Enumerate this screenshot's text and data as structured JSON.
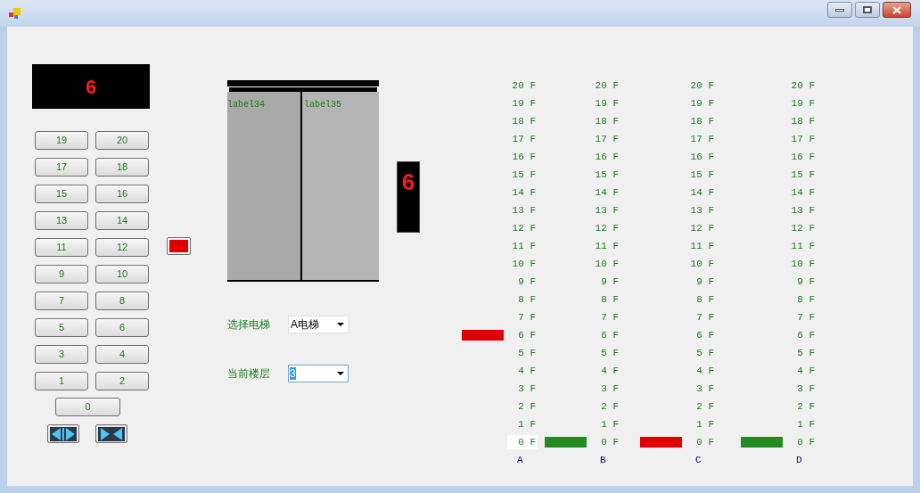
{
  "floor_display": {
    "value": "6"
  },
  "floor_buttons": [
    "19",
    "20",
    "17",
    "18",
    "15",
    "16",
    "13",
    "14",
    "11",
    "12",
    "9",
    "10",
    "7",
    "8",
    "5",
    "6",
    "3",
    "4",
    "1",
    "2"
  ],
  "ground_button": "0",
  "door_buttons": [
    {
      "kind": "open"
    },
    {
      "kind": "close"
    }
  ],
  "alarm_lamp": {
    "on": true
  },
  "doors": {
    "left_label": "label34",
    "right_label": "label35"
  },
  "side_display": {
    "value": "6"
  },
  "elevator_select": {
    "label": "选择电梯",
    "value": "A电梯"
  },
  "floor_select": {
    "label": "当前楼层",
    "value": "3",
    "selected": true
  },
  "shafts": [
    {
      "name": "A",
      "floors": [
        {
          "label": "20 F",
          "highlighted": false
        },
        {
          "label": "19 F",
          "highlighted": false
        },
        {
          "label": "18 F",
          "highlighted": false
        },
        {
          "label": "17 F",
          "highlighted": false
        },
        {
          "label": "16 F",
          "highlighted": false
        },
        {
          "label": "15 F",
          "highlighted": false
        },
        {
          "label": "14 F",
          "highlighted": false
        },
        {
          "label": "13 F",
          "highlighted": false
        },
        {
          "label": "12 F",
          "highlighted": false
        },
        {
          "label": "11 F",
          "highlighted": false
        },
        {
          "label": "10 F",
          "highlighted": false
        },
        {
          "label": "9 F",
          "highlighted": false
        },
        {
          "label": "8 F",
          "highlighted": false
        },
        {
          "label": "7 F",
          "highlighted": false
        },
        {
          "label": "6 F",
          "highlighted": false,
          "color": "#e00000"
        },
        {
          "label": "5 F",
          "highlighted": false
        },
        {
          "label": "4 F",
          "highlighted": false
        },
        {
          "label": "3 F",
          "highlighted": false
        },
        {
          "label": "2 F",
          "highlighted": false
        },
        {
          "label": "1 F",
          "highlighted": false
        },
        {
          "label": "0 F",
          "highlighted": true
        }
      ]
    },
    {
      "name": "B",
      "floors": [
        {
          "label": "20 F",
          "highlighted": false
        },
        {
          "label": "19 F",
          "highlighted": false
        },
        {
          "label": "18 F",
          "highlighted": false
        },
        {
          "label": "17 F",
          "highlighted": false
        },
        {
          "label": "16 F",
          "highlighted": false
        },
        {
          "label": "15 F",
          "highlighted": false
        },
        {
          "label": "14 F",
          "highlighted": false
        },
        {
          "label": "13 F",
          "highlighted": false
        },
        {
          "label": "12 F",
          "highlighted": false
        },
        {
          "label": "11 F",
          "highlighted": false
        },
        {
          "label": "10 F",
          "highlighted": false
        },
        {
          "label": "9 F",
          "highlighted": false
        },
        {
          "label": "8 F",
          "highlighted": false
        },
        {
          "label": "7 F",
          "highlighted": false
        },
        {
          "label": "6 F",
          "highlighted": false
        },
        {
          "label": "5 F",
          "highlighted": false
        },
        {
          "label": "4 F",
          "highlighted": false
        },
        {
          "label": "3 F",
          "highlighted": false
        },
        {
          "label": "2 F",
          "highlighted": false
        },
        {
          "label": "1 F",
          "highlighted": false
        },
        {
          "label": "0 F",
          "highlighted": false,
          "color": "#228b22"
        }
      ]
    },
    {
      "name": "C",
      "floors": [
        {
          "label": "20 F",
          "highlighted": false
        },
        {
          "label": "19 F",
          "highlighted": false
        },
        {
          "label": "18 F",
          "highlighted": false
        },
        {
          "label": "17 F",
          "highlighted": false
        },
        {
          "label": "16 F",
          "highlighted": false
        },
        {
          "label": "15 F",
          "highlighted": false
        },
        {
          "label": "14 F",
          "highlighted": false
        },
        {
          "label": "13 F",
          "highlighted": false
        },
        {
          "label": "12 F",
          "highlighted": false
        },
        {
          "label": "11 F",
          "highlighted": false
        },
        {
          "label": "10 F",
          "highlighted": false
        },
        {
          "label": "9 F",
          "highlighted": false
        },
        {
          "label": "8 F",
          "highlighted": false
        },
        {
          "label": "7 F",
          "highlighted": false
        },
        {
          "label": "6 F",
          "highlighted": false
        },
        {
          "label": "5 F",
          "highlighted": false
        },
        {
          "label": "4 F",
          "highlighted": false
        },
        {
          "label": "3 F",
          "highlighted": false
        },
        {
          "label": "2 F",
          "highlighted": false
        },
        {
          "label": "1 F",
          "highlighted": false
        },
        {
          "label": "0 F",
          "highlighted": false,
          "color": "#e00000"
        }
      ]
    },
    {
      "name": "D",
      "floors": [
        {
          "label": "20 F",
          "highlighted": false
        },
        {
          "label": "19 F",
          "highlighted": false
        },
        {
          "label": "18 F",
          "highlighted": false
        },
        {
          "label": "17 F",
          "highlighted": false
        },
        {
          "label": "16 F",
          "highlighted": false
        },
        {
          "label": "15 F",
          "highlighted": false
        },
        {
          "label": "14 F",
          "highlighted": false
        },
        {
          "label": "13 F",
          "highlighted": false
        },
        {
          "label": "12 F",
          "highlighted": false
        },
        {
          "label": "11 F",
          "highlighted": false
        },
        {
          "label": "10 F",
          "highlighted": false
        },
        {
          "label": "9 F",
          "highlighted": false
        },
        {
          "label": "8 F",
          "highlighted": false
        },
        {
          "label": "7 F",
          "highlighted": false
        },
        {
          "label": "6 F",
          "highlighted": false
        },
        {
          "label": "5 F",
          "highlighted": false
        },
        {
          "label": "4 F",
          "highlighted": false
        },
        {
          "label": "3 F",
          "highlighted": false
        },
        {
          "label": "2 F",
          "highlighted": false
        },
        {
          "label": "1 F",
          "highlighted": false
        },
        {
          "label": "0 F",
          "highlighted": false,
          "color": "#228b22"
        }
      ]
    }
  ]
}
